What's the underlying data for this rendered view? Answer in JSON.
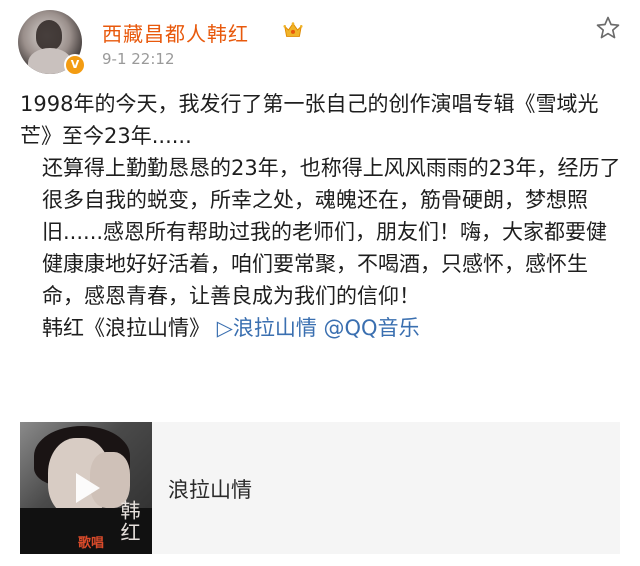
{
  "user": {
    "name": "西藏昌都人韩红",
    "verified_badge": "V",
    "post_time": "9-1 22:12"
  },
  "icons": {
    "crown": "crown-icon",
    "favorite": "star-outline-icon",
    "play": "play-icon"
  },
  "post": {
    "paragraph1": "1998年的今天，我发行了第一张自己的创作演唱专辑《雪域光芒》至今23年......",
    "paragraph2": "还算得上勤勤恳恳的23年，也称得上风风雨雨的23年，经历了很多自我的蜕变，所幸之处，魂魄还在，筋骨硬朗，梦想照旧......感恩所有帮助过我的老师们，朋友们！嗨，大家都要健健康康地好好活着，咱们要常聚，不喝酒，只感怀，感怀生命，感恩青春，让善良成为我们的信仰！",
    "music_prefix": "韩红《浪拉山情》",
    "music_link": "▷浪拉山情 @QQ音乐"
  },
  "card": {
    "song_title": "浪拉山情",
    "cover_artist_text": "韩红",
    "cover_label_text": "歌唱"
  },
  "colors": {
    "username": "#e8590c",
    "link": "#3a6fb0",
    "timestamp": "#9a9a9a",
    "badge": "#f39c12",
    "card_bg": "#f5f5f5"
  }
}
